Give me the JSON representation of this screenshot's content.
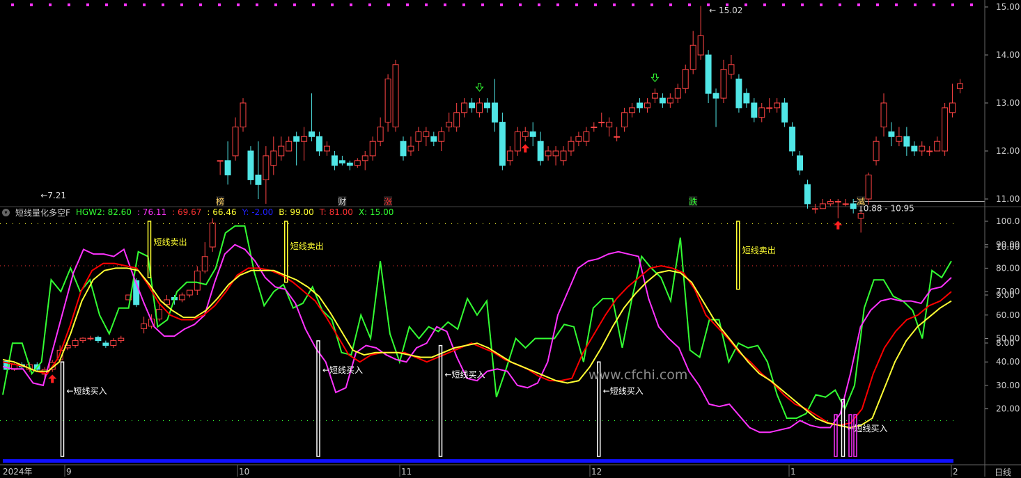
{
  "colors": {
    "up": "#ff4444",
    "down": "#50e6e6",
    "hgw2": "#33ff33",
    "a": "#ff33ff",
    "b": "#ff0000",
    "t": "#ffff33",
    "y": "#1010ff",
    "axis": "#cccccc",
    "grid": "#555555"
  },
  "price_axis": {
    "ticks": [
      "15.00",
      "14.00",
      "13.00",
      "12.00",
      "11.00",
      "10.00",
      "9.00",
      "8.00"
    ]
  },
  "indicator_axis": {
    "ticks": [
      "100.0",
      "90.00",
      "80.00",
      "70.00",
      "60.00",
      "50.00",
      "40.00",
      "30.00",
      "20.00"
    ]
  },
  "annotations": {
    "high_label": "15.02",
    "low_label": "7.21",
    "range_label": "10.88 - 10.95"
  },
  "event_tags": [
    "榜",
    "财",
    "涨",
    "跌",
    "减"
  ],
  "indicator": {
    "name": "短线量化多空F",
    "hgw2": "HGW2: 82.60",
    "a": ": 76.11",
    "b_val": ": 69.67",
    "c_val": ": 66.46",
    "y": "Y: -2.00",
    "bb": "B: 99.00",
    "t": "T: 81.00",
    "x": "X: 15.00"
  },
  "signals": {
    "buy": "短线买入",
    "sell": "短线卖出"
  },
  "time_axis": [
    "2024年",
    "9",
    "10",
    "11",
    "12",
    "1",
    "2"
  ],
  "timeframe": "日线",
  "watermark": "www.cfchi.com",
  "chart_data": [
    {
      "type": "candlestick",
      "title": "",
      "ylim": [
        7.5,
        15.2
      ],
      "candles": [
        [
          7.62,
          7.45,
          7.65,
          7.45
        ],
        [
          7.45,
          7.55,
          7.58,
          7.42
        ],
        [
          7.55,
          7.5,
          7.6,
          7.45
        ],
        [
          7.45,
          7.55,
          7.6,
          7.4
        ],
        [
          7.55,
          7.45,
          7.6,
          7.4
        ],
        [
          7.35,
          7.45,
          7.5,
          7.21
        ],
        [
          7.45,
          7.6,
          7.65,
          7.4
        ],
        [
          7.65,
          7.85,
          7.95,
          7.6
        ],
        [
          7.9,
          7.95,
          8.0,
          7.85
        ],
        [
          7.95,
          8.05,
          8.1,
          7.9
        ],
        [
          8.05,
          8.1,
          8.12,
          8.0
        ],
        [
          8.1,
          8.1,
          8.15,
          8.05
        ],
        [
          8.12,
          8.05,
          8.15,
          8.0
        ],
        [
          8.0,
          7.95,
          8.05,
          7.9
        ],
        [
          7.95,
          8.05,
          8.1,
          7.9
        ],
        [
          8.05,
          8.1,
          8.15,
          8.0
        ],
        [
          8.9,
          9.0,
          8.9,
          8.9
        ],
        [
          9.3,
          8.8,
          9.35,
          8.75
        ],
        [
          8.3,
          8.4,
          8.55,
          8.2
        ],
        [
          8.35,
          8.5,
          8.6,
          8.3
        ],
        [
          8.5,
          8.7,
          8.8,
          8.45
        ],
        [
          8.8,
          8.9,
          9.0,
          8.75
        ],
        [
          8.95,
          8.9,
          9.0,
          8.8
        ],
        [
          8.9,
          9.0,
          9.05,
          8.85
        ],
        [
          9.0,
          9.1,
          9.1,
          8.95
        ],
        [
          9.1,
          9.5,
          9.6,
          9.0
        ],
        [
          9.5,
          9.8,
          10.1,
          9.45
        ],
        [
          10.0,
          10.5,
          10.6,
          9.9
        ],
        [
          11.8,
          11.8,
          11.8,
          11.5
        ],
        [
          11.8,
          11.5,
          12.2,
          11.3
        ],
        [
          11.9,
          12.5,
          12.7,
          11.8
        ],
        [
          12.5,
          13.0,
          13.1,
          12.4
        ],
        [
          12.0,
          11.4,
          12.1,
          11.3
        ],
        [
          11.5,
          11.3,
          12.2,
          11.0
        ],
        [
          11.4,
          11.9,
          12.1,
          10.9
        ],
        [
          11.7,
          12.0,
          12.3,
          11.5
        ],
        [
          11.9,
          12.1,
          12.3,
          11.8
        ],
        [
          12.0,
          12.2,
          12.3,
          12.0
        ],
        [
          12.3,
          12.2,
          12.4,
          11.7
        ],
        [
          12.2,
          12.3,
          12.5,
          11.8
        ],
        [
          12.4,
          12.3,
          13.2,
          12.2
        ],
        [
          12.3,
          12.0,
          12.4,
          11.9
        ],
        [
          12.0,
          12.1,
          12.2,
          11.9
        ],
        [
          11.9,
          11.7,
          12.0,
          11.6
        ],
        [
          11.8,
          11.75,
          11.9,
          11.7
        ],
        [
          11.75,
          11.7,
          11.8,
          11.6
        ],
        [
          11.7,
          11.8,
          11.85,
          11.65
        ],
        [
          11.8,
          11.9,
          12.0,
          11.6
        ],
        [
          11.9,
          12.2,
          12.3,
          11.8
        ],
        [
          12.2,
          12.5,
          12.7,
          12.1
        ],
        [
          12.6,
          13.5,
          13.6,
          12.4
        ],
        [
          12.5,
          13.8,
          13.9,
          12.4
        ],
        [
          12.2,
          11.9,
          12.3,
          11.8
        ],
        [
          12.0,
          12.1,
          12.3,
          11.9
        ],
        [
          12.2,
          12.4,
          12.5,
          12.0
        ],
        [
          12.3,
          12.4,
          12.5,
          12.1
        ],
        [
          12.3,
          12.2,
          12.4,
          12.1
        ],
        [
          12.2,
          12.4,
          12.5,
          12.0
        ],
        [
          12.5,
          12.6,
          12.8,
          12.4
        ],
        [
          12.5,
          12.8,
          13.0,
          12.4
        ],
        [
          12.8,
          13.0,
          13.1,
          12.7
        ],
        [
          13.0,
          12.9,
          13.1,
          12.8
        ],
        [
          12.8,
          13.0,
          13.1,
          12.7
        ],
        [
          13.0,
          12.9,
          13.1,
          12.8
        ],
        [
          13.0,
          12.6,
          13.5,
          12.4
        ],
        [
          12.6,
          11.7,
          12.8,
          11.6
        ],
        [
          11.8,
          12.0,
          12.1,
          11.7
        ],
        [
          12.0,
          12.4,
          12.5,
          11.9
        ],
        [
          12.3,
          12.4,
          12.5,
          12.2
        ],
        [
          12.4,
          12.3,
          12.6,
          12.1
        ],
        [
          12.2,
          11.8,
          12.4,
          11.7
        ],
        [
          11.9,
          12.0,
          12.1,
          11.8
        ],
        [
          11.9,
          12.0,
          12.1,
          11.7
        ],
        [
          11.8,
          12.0,
          12.1,
          11.7
        ],
        [
          12.0,
          12.2,
          12.3,
          11.9
        ],
        [
          12.2,
          12.3,
          12.4,
          12.1
        ],
        [
          12.2,
          12.4,
          12.5,
          12.1
        ],
        [
          12.5,
          12.5,
          12.6,
          12.4
        ],
        [
          12.6,
          12.6,
          12.8,
          12.5
        ],
        [
          12.5,
          12.6,
          12.7,
          12.3
        ],
        [
          12.3,
          12.3,
          12.5,
          12.2
        ],
        [
          12.5,
          12.8,
          12.9,
          12.4
        ],
        [
          12.8,
          12.9,
          13.0,
          12.7
        ],
        [
          13.0,
          12.9,
          13.1,
          12.8
        ],
        [
          12.9,
          13.0,
          13.1,
          12.8
        ],
        [
          13.1,
          13.2,
          13.3,
          13.0
        ],
        [
          13.1,
          13.0,
          13.2,
          12.9
        ],
        [
          13.0,
          13.1,
          13.2,
          12.9
        ],
        [
          13.1,
          13.3,
          13.4,
          13.0
        ],
        [
          13.3,
          13.7,
          13.8,
          13.2
        ],
        [
          13.7,
          14.2,
          14.5,
          13.6
        ],
        [
          14.0,
          14.4,
          15.02,
          13.9
        ],
        [
          14.0,
          13.2,
          14.1,
          13.0
        ],
        [
          13.2,
          13.1,
          13.3,
          12.5
        ],
        [
          13.1,
          13.7,
          13.9,
          13.0
        ],
        [
          13.6,
          13.8,
          14.0,
          13.5
        ],
        [
          13.5,
          12.9,
          13.6,
          12.8
        ],
        [
          13.2,
          13.0,
          13.3,
          12.9
        ],
        [
          13.0,
          12.7,
          13.1,
          12.6
        ],
        [
          12.7,
          12.9,
          13.0,
          12.6
        ],
        [
          12.9,
          12.9,
          13.1,
          12.8
        ],
        [
          12.9,
          13.0,
          13.1,
          12.8
        ],
        [
          13.0,
          12.6,
          13.1,
          12.5
        ],
        [
          12.5,
          12.0,
          12.6,
          11.9
        ],
        [
          11.9,
          11.6,
          12.0,
          11.5
        ],
        [
          11.3,
          10.9,
          11.4,
          10.8
        ],
        [
          10.8,
          10.8,
          10.9,
          10.7
        ],
        [
          10.8,
          10.9,
          11.0,
          10.8
        ],
        [
          10.9,
          10.95,
          11.0,
          10.85
        ],
        [
          10.95,
          10.95,
          11.0,
          10.6
        ],
        [
          10.9,
          10.9,
          11.0,
          10.85
        ],
        [
          10.9,
          10.8,
          11.0,
          10.7
        ],
        [
          10.6,
          10.7,
          10.9,
          10.3
        ],
        [
          11.0,
          11.5,
          11.55,
          10.88
        ],
        [
          11.8,
          12.2,
          12.3,
          11.7
        ],
        [
          12.5,
          13.0,
          13.2,
          12.3
        ],
        [
          12.4,
          12.3,
          12.6,
          12.1
        ],
        [
          12.2,
          12.3,
          12.5,
          12.1
        ],
        [
          12.3,
          12.1,
          12.5,
          11.9
        ],
        [
          12.1,
          12.0,
          12.2,
          11.9
        ],
        [
          12.0,
          12.1,
          12.2,
          11.9
        ],
        [
          12.0,
          12.0,
          12.1,
          11.9
        ],
        [
          12.0,
          12.2,
          12.3,
          12.0
        ],
        [
          12.0,
          12.9,
          13.0,
          11.9
        ],
        [
          12.8,
          13.0,
          13.4,
          12.7
        ],
        [
          13.3,
          13.4,
          13.5,
          13.2
        ]
      ],
      "signal_up_idx": [
        6,
        68,
        109
      ],
      "signal_down_idx": [
        62,
        85
      ],
      "tag_idx": [
        28,
        44,
        50,
        90,
        112
      ],
      "range_line_price": 10.95
    },
    {
      "type": "line",
      "title": "",
      "ylim": [
        0,
        103
      ],
      "x": [
        0,
        2,
        4,
        6,
        8,
        10,
        12,
        14,
        16,
        18,
        20,
        22,
        24,
        26,
        28,
        30,
        32,
        34,
        36,
        38,
        40,
        42,
        44,
        46,
        48,
        50,
        52,
        54,
        56,
        58,
        60,
        62,
        64,
        66,
        68,
        70,
        72,
        74,
        76,
        78,
        80,
        82,
        84,
        86,
        88,
        90,
        92,
        94,
        96,
        98,
        100,
        102,
        104,
        106,
        108,
        110,
        112,
        114,
        116,
        118,
        120,
        122,
        124,
        126,
        128,
        130
      ],
      "series": [
        {
          "name": "HGW2",
          "values": [
            26,
            48,
            48,
            35,
            40,
            75,
            70,
            80,
            70,
            75,
            60,
            52,
            63,
            63,
            87,
            85,
            55,
            58,
            70,
            74,
            74,
            73,
            80,
            95,
            98,
            98,
            78,
            64,
            70,
            73,
            63,
            65,
            72,
            62,
            58,
            44,
            43,
            60,
            50,
            83,
            52,
            40,
            55,
            50,
            55,
            53,
            57,
            54,
            67,
            60,
            66,
            25,
            37,
            50,
            46,
            50,
            50,
            50,
            56,
            55,
            40,
            63,
            67,
            67,
            46,
            67,
            85,
            80,
            76,
            66,
            93,
            45,
            42,
            58,
            58,
            40,
            48,
            46,
            47,
            40,
            26,
            16,
            16,
            18,
            26,
            25,
            28,
            20,
            30,
            63,
            75,
            75,
            68,
            66,
            62,
            50,
            79,
            76,
            83
          ]
        },
        {
          "name": "",
          "values": [
            38,
            37,
            37,
            31,
            30,
            46,
            62,
            78,
            88,
            86,
            86,
            85,
            88,
            76,
            65,
            55,
            51,
            51,
            54,
            56,
            60,
            74,
            86,
            90,
            88,
            83,
            76,
            72,
            71,
            65,
            54,
            46,
            40,
            27,
            29,
            44,
            47,
            46,
            43,
            41,
            40,
            46,
            48,
            55,
            53,
            42,
            33,
            32,
            36,
            37,
            36,
            30,
            29,
            31,
            40,
            60,
            70,
            80,
            83,
            84,
            86,
            87,
            86,
            85,
            67,
            55,
            50,
            46,
            36,
            30,
            22,
            21,
            22,
            17,
            12,
            10,
            10,
            11,
            12,
            15,
            13,
            12,
            12,
            18,
            35,
            55,
            62,
            66,
            67,
            66,
            66,
            65,
            71,
            72,
            76
          ]
        },
        {
          "name": "",
          "values": [
            40,
            39,
            38,
            36,
            35,
            42,
            55,
            70,
            79,
            82,
            82,
            81,
            80,
            73,
            65,
            60,
            58,
            58,
            60,
            64,
            70,
            77,
            80,
            80,
            79,
            77,
            74,
            70,
            66,
            59,
            51,
            43,
            40,
            43,
            44,
            44,
            44,
            42,
            40,
            42,
            44,
            46,
            48,
            46,
            44,
            41,
            39,
            37,
            34,
            32,
            32,
            33,
            44,
            52,
            60,
            67,
            72,
            76,
            80,
            81,
            80,
            78,
            71,
            60,
            55,
            50,
            44,
            40,
            35,
            31,
            26,
            22,
            20,
            17,
            14,
            13,
            14,
            20,
            35,
            46,
            53,
            58,
            60,
            64,
            66,
            70
          ]
        },
        {
          "name": "",
          "values": [
            41,
            40,
            38,
            36,
            36,
            40,
            52,
            66,
            75,
            79,
            80,
            80,
            79,
            73,
            66,
            62,
            59,
            59,
            62,
            67,
            73,
            77,
            79,
            79,
            79,
            77,
            75,
            72,
            68,
            61,
            53,
            45,
            43,
            44,
            44,
            44,
            43,
            42,
            42,
            44,
            46,
            47,
            48,
            46,
            43,
            40,
            38,
            36,
            34,
            32,
            31,
            32,
            38,
            46,
            55,
            63,
            69,
            74,
            78,
            79,
            78,
            74,
            66,
            58,
            52,
            46,
            40,
            35,
            32,
            28,
            24,
            20,
            16,
            14,
            13,
            12,
            13,
            16,
            28,
            40,
            49,
            55,
            59,
            63,
            66
          ]
        }
      ],
      "levels": {
        "top": 99,
        "upper": 81,
        "lower": 15
      },
      "buy_x": [
        2,
        44,
        62,
        83,
        118
      ],
      "sell_x": [
        18,
        35,
        103
      ],
      "pink_x": [
        111,
        114,
        115
      ]
    }
  ]
}
